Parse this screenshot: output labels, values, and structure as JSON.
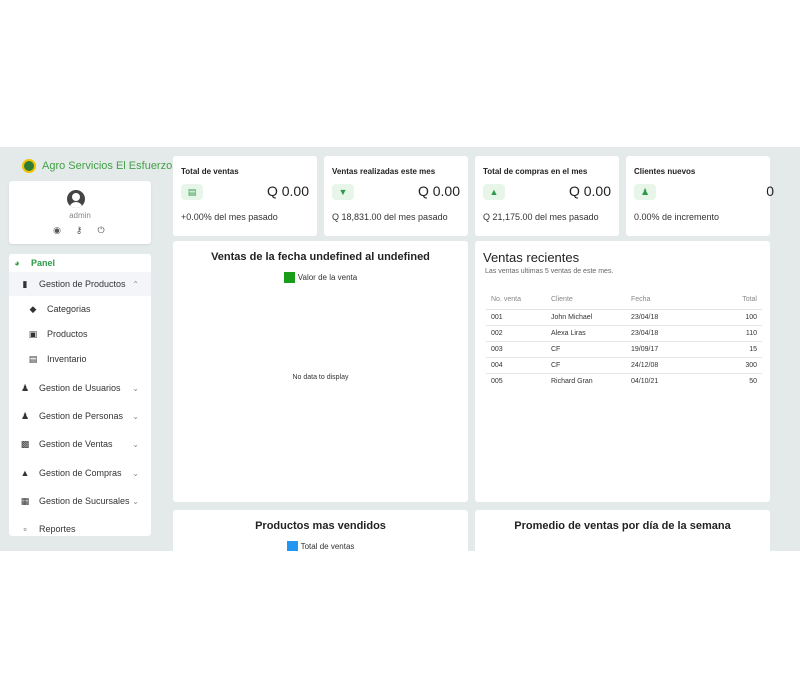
{
  "brand": {
    "name": "Agro Servicios El Esfuerzo"
  },
  "user": {
    "name": "admin",
    "icons": [
      "user-circle-icon",
      "key-icon",
      "power-icon"
    ]
  },
  "nav": {
    "panel": "Panel",
    "productos_group": "Gestion de Productos",
    "productos_sub": [
      "Categorias",
      "Productos",
      "Inventario"
    ],
    "groups": [
      "Gestion de Usuarios",
      "Gestion de Personas",
      "Gestion de Ventas",
      "Gestion de Compras",
      "Gestion de Sucursales"
    ],
    "reportes": "Reportes"
  },
  "stats": [
    {
      "title": "Total de ventas",
      "value": "Q 0.00",
      "sub": "+0.00% del mes pasado",
      "icon": "money-icon"
    },
    {
      "title": "Ventas realizadas este mes",
      "value": "Q 0.00",
      "sub": "Q 18,831.00 del mes pasado",
      "icon": "cart-icon"
    },
    {
      "title": "Total de compras en el mes",
      "value": "Q 0.00",
      "sub": "Q 21,175.00 del mes pasado",
      "icon": "bag-icon"
    },
    {
      "title": "Clientes nuevos",
      "value": "0",
      "sub": "0.00% de incremento",
      "icon": "users-icon"
    }
  ],
  "sales_chart": {
    "title": "Ventas de la fecha undefined al undefined",
    "legend": "Valor de la venta",
    "legend_color": "#1a9e1a",
    "empty_text": "No data to display"
  },
  "recent_sales": {
    "title": "Ventas recientes",
    "subtitle": "Las ventas ultimas 5 ventas de este mes.",
    "headers": [
      "No. venta",
      "Cliente",
      "Fecha",
      "Total"
    ],
    "rows": [
      [
        "001",
        "John Michael",
        "23/04/18",
        "100"
      ],
      [
        "002",
        "Alexa Liras",
        "23/04/18",
        "110"
      ],
      [
        "003",
        "CF",
        "19/09/17",
        "15"
      ],
      [
        "004",
        "CF",
        "24/12/08",
        "300"
      ],
      [
        "005",
        "Richard Gran",
        "04/10/21",
        "50"
      ]
    ]
  },
  "top_products": {
    "title": "Productos mas vendidos",
    "legend": "Total de ventas",
    "legend_color": "#2196f3"
  },
  "weekday_avg": {
    "title": "Promedio de ventas por día de la semana"
  }
}
